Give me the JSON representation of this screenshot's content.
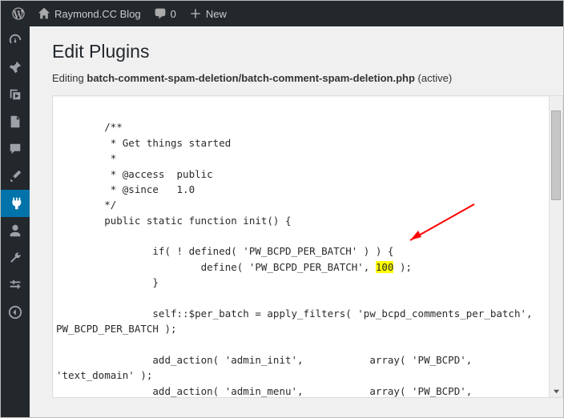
{
  "topbar": {
    "site_name": "Raymond.CC Blog",
    "comments_count": "0",
    "new_label": "New"
  },
  "sidebar": {
    "items": [
      "dashboard",
      "pin",
      "media",
      "pages",
      "comments",
      "appearance",
      "plugins",
      "users",
      "tools",
      "settings",
      "collapse"
    ]
  },
  "page": {
    "title": "Edit Plugins",
    "editing_label": "Editing ",
    "file_path": "batch-comment-spam-deletion/batch-comment-spam-deletion.php",
    "active_suffix": " (active)"
  },
  "code": {
    "l1": "        /**",
    "l2": "         * Get things started",
    "l3": "         *",
    "l4": "         * @access  public",
    "l5": "         * @since   1.0",
    "l6": "        */",
    "l7": "        public static function init() {",
    "l8": "",
    "l9": "                if( ! defined( 'PW_BCPD_PER_BATCH' ) ) {",
    "l10a": "                        define( 'PW_BCPD_PER_BATCH', ",
    "l10h": "100",
    "l10b": " );",
    "l11": "                }",
    "l12": "",
    "l13": "                self::$per_batch = apply_filters( 'pw_bcpd_comments_per_batch',",
    "l14": "PW_BCPD_PER_BATCH );",
    "l15": "",
    "l16": "                add_action( 'admin_init',           array( 'PW_BCPD',",
    "l17": "'text_domain' );",
    "l18": "                add_action( 'admin_menu',           array( 'PW_BCPD',"
  }
}
